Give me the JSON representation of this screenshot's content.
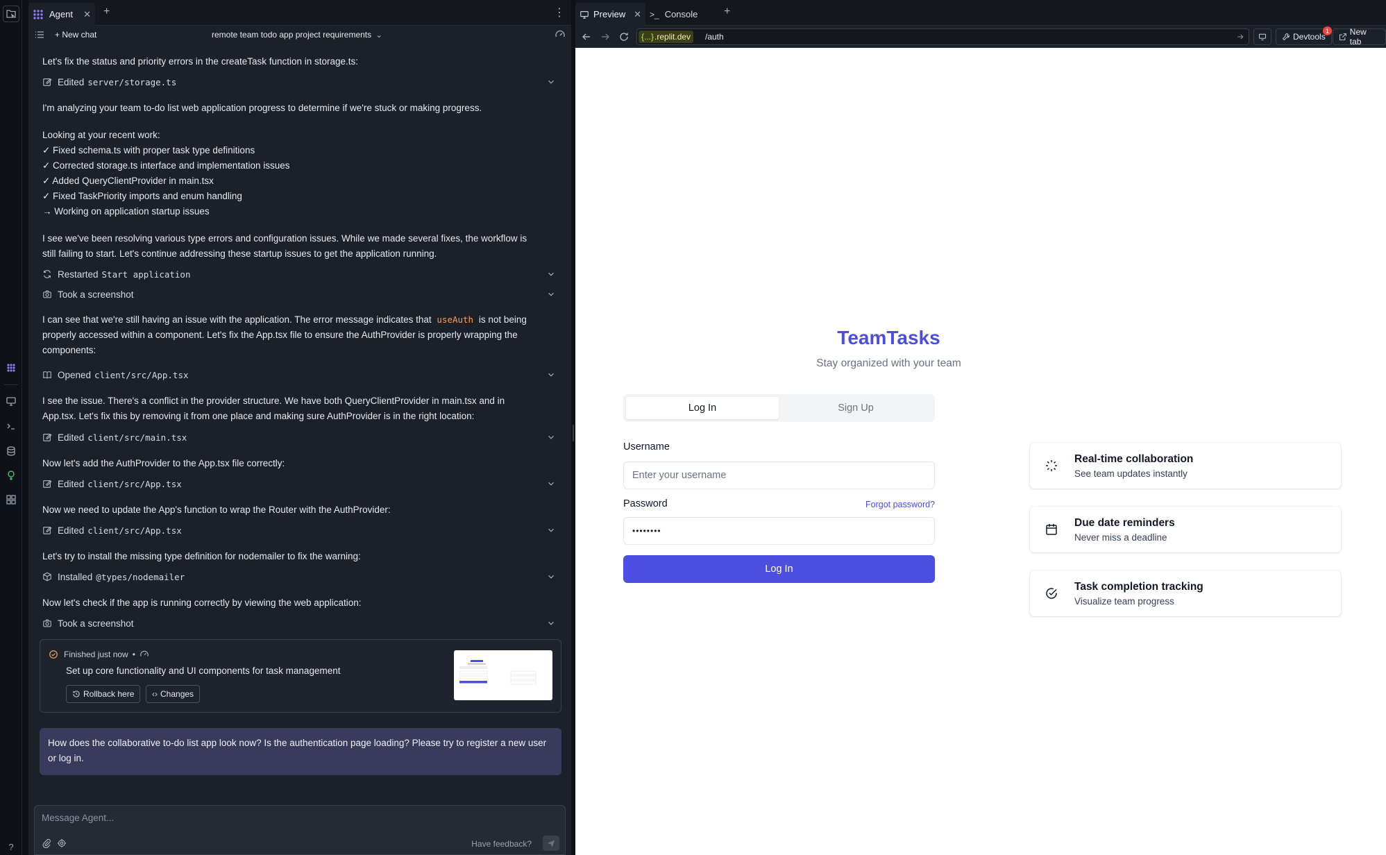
{
  "agent_tab": {
    "label": "Agent"
  },
  "agent_header": {
    "new_chat": "New chat",
    "chat_title": "remote team todo app project requirements"
  },
  "messages": [
    {
      "type": "text",
      "lines": [
        "Let's fix the status and priority errors in the createTask function in storage.ts:"
      ]
    },
    {
      "type": "step",
      "icon": "edit-icon",
      "label": "Edited",
      "code": "server/storage.ts"
    },
    {
      "type": "text",
      "lines": [
        "I'm analyzing your team to-do list web application progress to determine if we're stuck or making progress."
      ]
    },
    {
      "type": "text",
      "lines": [
        "Looking at your recent work:",
        "✓ Fixed schema.ts with proper task type definitions",
        "✓ Corrected storage.ts interface and implementation issues",
        "✓ Added QueryClientProvider in main.tsx",
        "✓ Fixed TaskPriority imports and enum handling",
        "→ Working on application startup issues"
      ]
    },
    {
      "type": "text",
      "lines": [
        "I see we've been resolving various type errors and configuration issues. While we made several fixes, the workflow is",
        "still failing to start. Let's continue addressing these startup issues to get the application running."
      ]
    },
    {
      "type": "step",
      "icon": "restart-icon",
      "label": "Restarted",
      "code": "Start application"
    },
    {
      "type": "step",
      "icon": "camera-icon",
      "label": "Took a screenshot",
      "code": ""
    },
    {
      "type": "text_code",
      "before": "I can see that we're still having an issue with the application. The error message indicates that",
      "code": "useAuth",
      "after": "is not being",
      "lines": [
        "properly accessed within a component. Let's fix the App.tsx file to ensure the AuthProvider is properly wrapping the",
        "components:"
      ]
    },
    {
      "type": "step",
      "icon": "book-icon",
      "label": "Opened",
      "code": "client/src/App.tsx"
    },
    {
      "type": "text",
      "lines": [
        "I see the issue. There's a conflict in the provider structure. We have both QueryClientProvider in main.tsx and in",
        "App.tsx. Let's fix this by removing it from one place and making sure AuthProvider is in the right location:"
      ]
    },
    {
      "type": "step",
      "icon": "edit-icon",
      "label": "Edited",
      "code": "client/src/main.tsx"
    },
    {
      "type": "text",
      "lines": [
        "Now let's add the AuthProvider to the App.tsx file correctly:"
      ]
    },
    {
      "type": "step",
      "icon": "edit-icon",
      "label": "Edited",
      "code": "client/src/App.tsx"
    },
    {
      "type": "text",
      "lines": [
        "Now we need to update the App's function to wrap the Router with the AuthProvider:"
      ]
    },
    {
      "type": "step",
      "icon": "edit-icon",
      "label": "Edited",
      "code": "client/src/App.tsx"
    },
    {
      "type": "text",
      "lines": [
        "Let's try to install the missing type definition for nodemailer to fix the warning:"
      ]
    },
    {
      "type": "step",
      "icon": "package-icon",
      "label": "Installed",
      "code": "@types/nodemailer"
    },
    {
      "type": "text",
      "lines": [
        "Now let's check if the app is running correctly by viewing the web application:"
      ]
    },
    {
      "type": "step",
      "icon": "camera-icon",
      "label": "Took a screenshot",
      "code": ""
    }
  ],
  "checkpoint": {
    "status": "Finished just now",
    "separator": "•",
    "description": "Set up core functionality and UI components for task management",
    "rollback_label": "Rollback here",
    "changes_label": "Changes"
  },
  "user_message": "How does the collaborative to-do list app look now? Is the authentication page loading? Please try to register a new user or log in.",
  "composer": {
    "placeholder": "Message Agent...",
    "feedback": "Have feedback?"
  },
  "preview_tabs": {
    "preview": "Preview",
    "console": "Console"
  },
  "urlbar": {
    "domain_braces": "{...}",
    "domain": ".replit.dev",
    "path": "/auth",
    "devtools": "Devtools",
    "devtools_badge": "1",
    "new_tab": "New tab"
  },
  "app": {
    "title": "TeamTasks",
    "subtitle": "Stay organized with your team",
    "tab_login": "Log In",
    "tab_signup": "Sign Up",
    "username_label": "Username",
    "username_placeholder": "Enter your username",
    "password_label": "Password",
    "forgot": "Forgot password?",
    "password_value": "••••••••",
    "login_button": "Log In",
    "features": [
      {
        "icon": "loader-icon",
        "title": "Real-time collaboration",
        "desc": "See team updates instantly"
      },
      {
        "icon": "calendar-icon",
        "title": "Due date reminders",
        "desc": "Never miss a deadline"
      },
      {
        "icon": "check-circle-icon",
        "title": "Task completion tracking",
        "desc": "Visualize team progress"
      }
    ]
  },
  "colors": {
    "accent": "#4b4ee0",
    "agent_bg": "#1c2029",
    "user_bubble": "#3a3b5c",
    "inline_code": "#ff9d5c"
  }
}
